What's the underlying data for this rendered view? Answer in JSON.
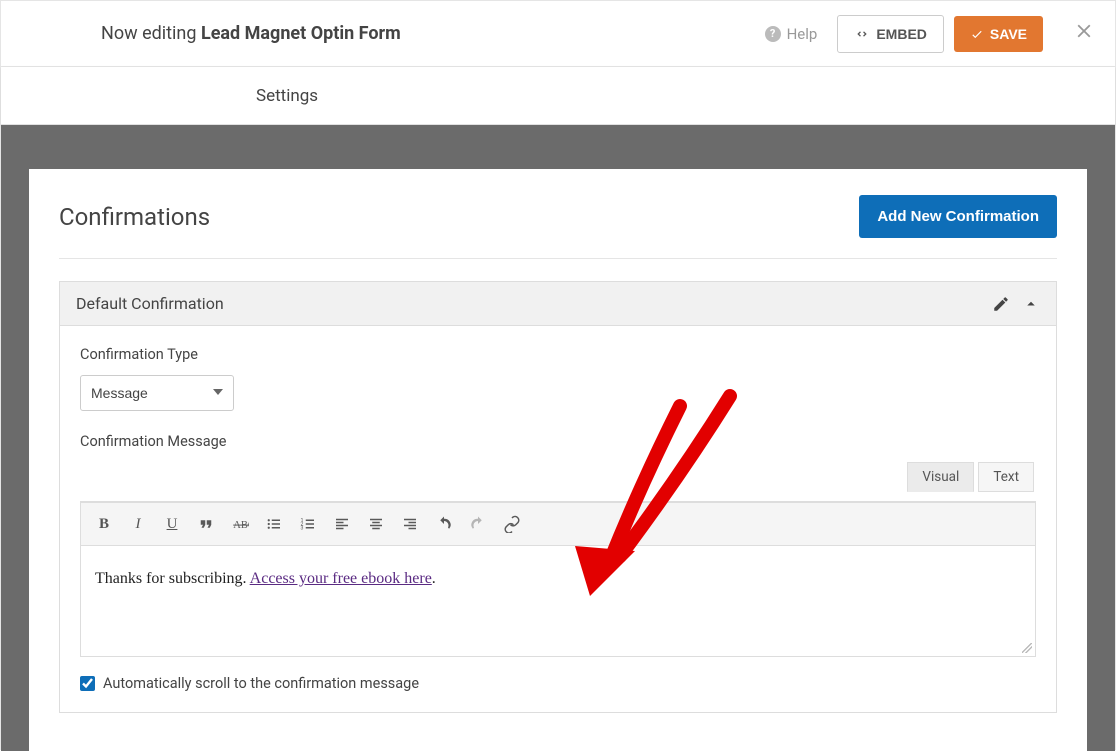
{
  "topbar": {
    "editing_prefix": "Now editing ",
    "form_name": "Lead Magnet Optin Form",
    "help_label": "Help",
    "embed_label": "EMBED",
    "save_label": "SAVE"
  },
  "tabs": {
    "settings": "Settings"
  },
  "panel": {
    "title": "Confirmations",
    "add_button": "Add New Confirmation"
  },
  "confirmation": {
    "name": "Default Confirmation",
    "type_label": "Confirmation Type",
    "type_value": "Message",
    "message_label": "Confirmation Message",
    "editor_tabs": {
      "visual": "Visual",
      "text": "Text"
    },
    "message_prefix": "Thanks for subscribing. ",
    "message_link": "Access your free ebook here",
    "message_suffix": ".",
    "auto_scroll_label": "Automatically scroll to the confirmation message",
    "auto_scroll_checked": true
  },
  "colors": {
    "accent": "#e27730",
    "primary_blue": "#0e6eb8"
  }
}
